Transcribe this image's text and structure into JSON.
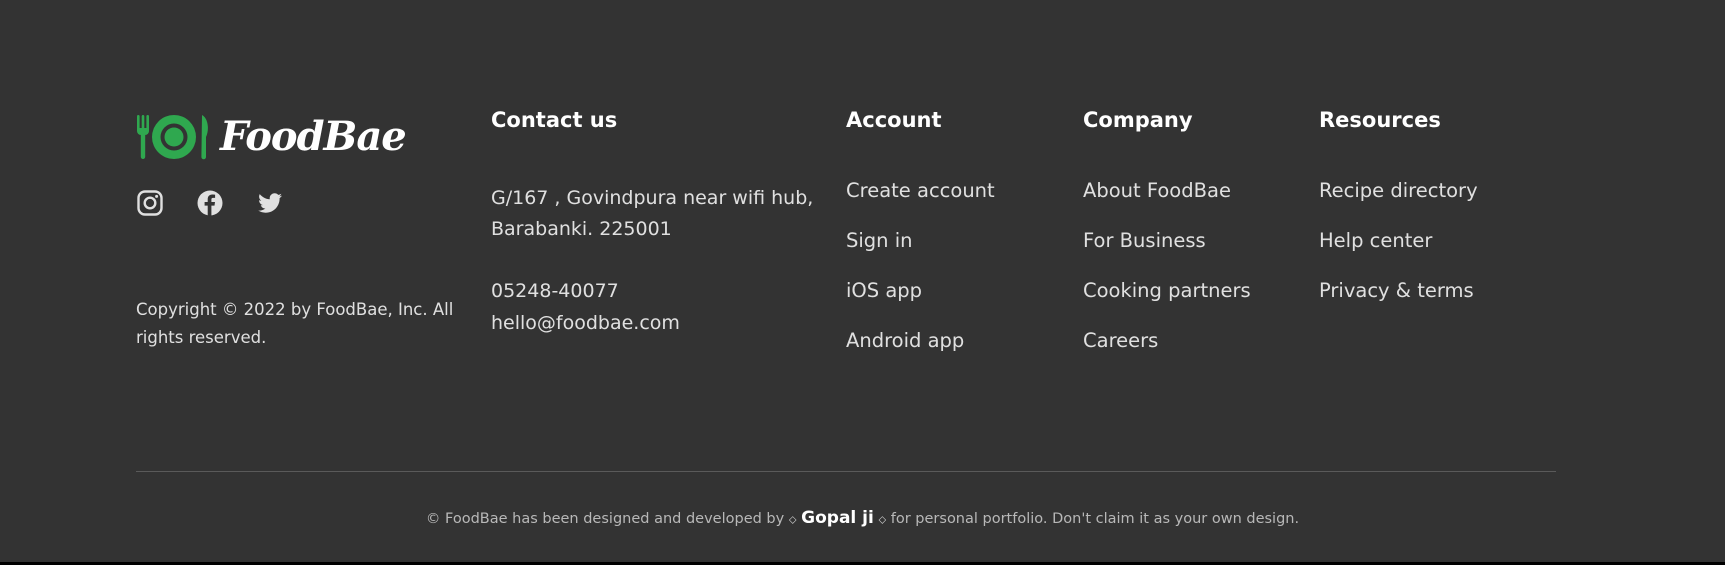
{
  "brand": {
    "name": "FoodBae",
    "accent_color": "#2fa84f",
    "logo_icon": "plate-with-fork-and-knife-icon"
  },
  "socials": [
    {
      "name": "instagram-icon",
      "label": "Instagram"
    },
    {
      "name": "facebook-icon",
      "label": "Facebook"
    },
    {
      "name": "twitter-icon",
      "label": "Twitter"
    }
  ],
  "copyright": "Copyright © 2022 by FoodBae, Inc. All rights reserved.",
  "contact": {
    "title": "Contact us",
    "address": "G/167 , Govindpura near wifi hub, Barabanki. 225001",
    "phone": "05248-40077",
    "email": "hello@foodbae.com"
  },
  "account": {
    "title": "Account",
    "links": [
      "Create account",
      "Sign in",
      "iOS app",
      "Android app"
    ]
  },
  "company": {
    "title": "Company",
    "links": [
      "About FoodBae",
      "For Business",
      "Cooking partners",
      "Careers"
    ]
  },
  "resources": {
    "title": "Resources",
    "links": [
      "Recipe directory",
      "Help center",
      "Privacy & terms"
    ]
  },
  "credit": {
    "prefix": "© FoodBae has been designed and developed by",
    "separator": "⬦",
    "author": "Gopal ji",
    "suffix": "for personal portfolio. Don't claim it as your own design."
  },
  "colors": {
    "background": "#333333",
    "text": "#e0e0e0",
    "heading": "#ffffff",
    "divider": "#5a5a5a"
  }
}
